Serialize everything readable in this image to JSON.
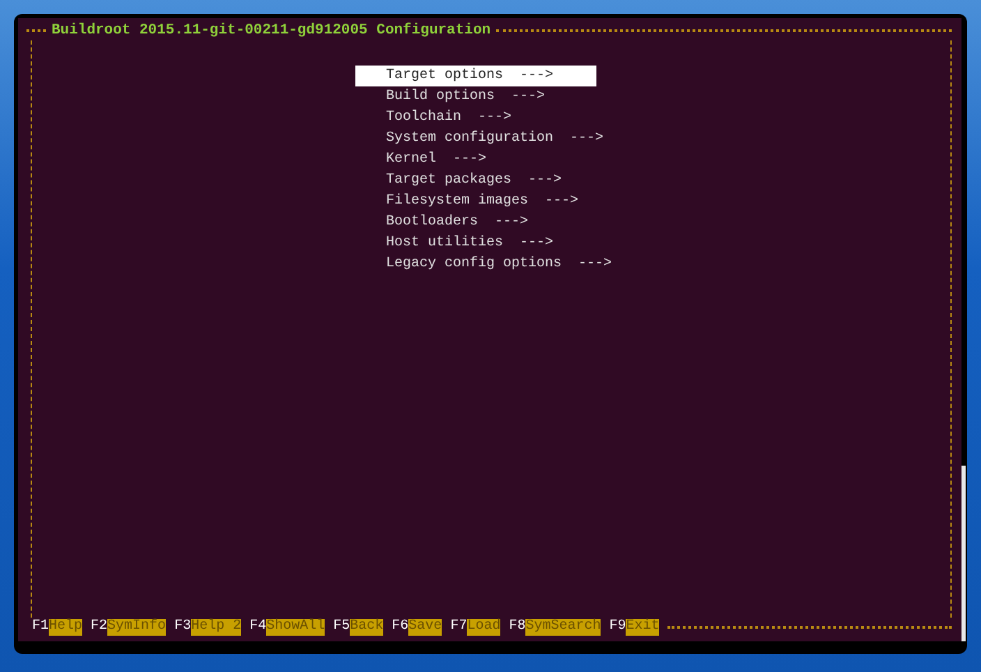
{
  "title": "Buildroot 2015.11-git-00211-gd912005 Configuration",
  "menu": [
    {
      "label": "Target options  --->",
      "selected": true
    },
    {
      "label": "Build options  --->",
      "selected": false
    },
    {
      "label": "Toolchain  --->",
      "selected": false
    },
    {
      "label": "System configuration  --->",
      "selected": false
    },
    {
      "label": "Kernel  --->",
      "selected": false
    },
    {
      "label": "Target packages  --->",
      "selected": false
    },
    {
      "label": "Filesystem images  --->",
      "selected": false
    },
    {
      "label": "Bootloaders  --->",
      "selected": false
    },
    {
      "label": "Host utilities  --->",
      "selected": false
    },
    {
      "label": "Legacy config options  --->",
      "selected": false
    }
  ],
  "keys": [
    {
      "key": "F1",
      "label": "Help"
    },
    {
      "key": "F2",
      "label": "SymInfo"
    },
    {
      "key": "F3",
      "label": "Help 2"
    },
    {
      "key": "F4",
      "label": "ShowAll"
    },
    {
      "key": "F5",
      "label": "Back"
    },
    {
      "key": "F6",
      "label": "Save"
    },
    {
      "key": "F7",
      "label": "Load"
    },
    {
      "key": "F8",
      "label": "SymSearch"
    },
    {
      "key": "F9",
      "label": "Exit"
    }
  ]
}
